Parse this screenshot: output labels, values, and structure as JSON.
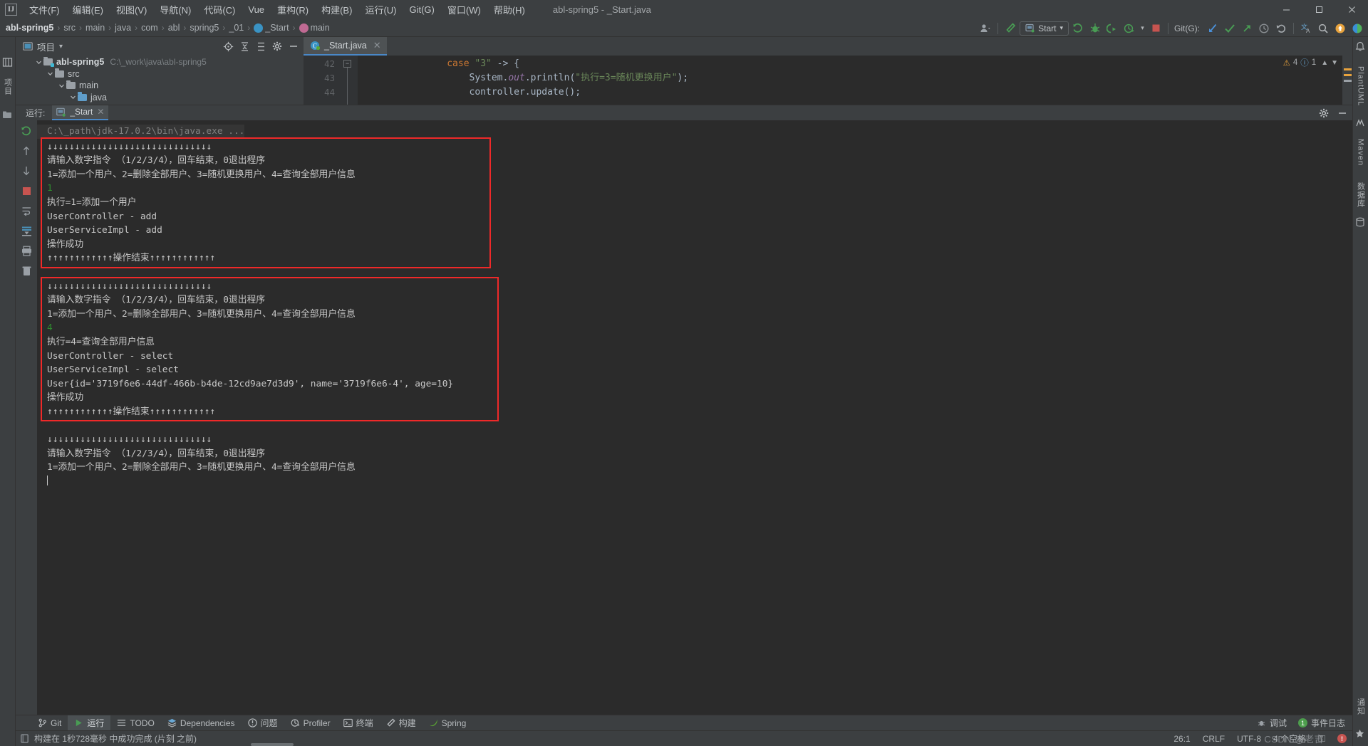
{
  "window": {
    "title": "abl-spring5 - _Start.java",
    "minimize": "–",
    "maximize": "☐",
    "close": "✕"
  },
  "menubar": {
    "logo": "IJ",
    "items": [
      {
        "label": "文件(F)"
      },
      {
        "label": "编辑(E)"
      },
      {
        "label": "视图(V)"
      },
      {
        "label": "导航(N)"
      },
      {
        "label": "代码(C)"
      },
      {
        "label": "Vue"
      },
      {
        "label": "重构(R)"
      },
      {
        "label": "构建(B)"
      },
      {
        "label": "运行(U)"
      },
      {
        "label": "Git(G)"
      },
      {
        "label": "窗口(W)"
      },
      {
        "label": "帮助(H)"
      }
    ]
  },
  "breadcrumb": {
    "items": [
      "abl-spring5",
      "src",
      "main",
      "java",
      "com",
      "abl",
      "spring5",
      "_01",
      "_Start",
      "main"
    ],
    "separator": "›"
  },
  "toolbar": {
    "run_config": "Start",
    "git_label": "Git(G):",
    "chevron": "▾"
  },
  "project_panel": {
    "title": "项目",
    "chevron": "▾",
    "tree": [
      {
        "label": "abl-spring5",
        "path": "C:\\_work\\java\\abl-spring5",
        "depth": 0,
        "expanded": true,
        "bold": true,
        "color": "gray"
      },
      {
        "label": "src",
        "path": "",
        "depth": 1,
        "expanded": true,
        "bold": false,
        "color": "gray"
      },
      {
        "label": "main",
        "path": "",
        "depth": 2,
        "expanded": true,
        "bold": false,
        "color": "gray"
      },
      {
        "label": "java",
        "path": "",
        "depth": 3,
        "expanded": true,
        "bold": false,
        "color": "blue"
      }
    ]
  },
  "editor": {
    "tab": "_Start.java",
    "tab_close": "✕",
    "lines": [
      {
        "num": "42",
        "segments": [
          {
            "t": "                ",
            "c": "plain"
          },
          {
            "t": "case",
            "c": "kw"
          },
          {
            "t": " ",
            "c": "plain"
          },
          {
            "t": "\"3\"",
            "c": "str"
          },
          {
            "t": " -> {",
            "c": "plain"
          }
        ]
      },
      {
        "num": "43",
        "segments": [
          {
            "t": "                    ",
            "c": "plain"
          },
          {
            "t": "System.",
            "c": "plain"
          },
          {
            "t": "out",
            "c": "field"
          },
          {
            "t": ".println(",
            "c": "plain"
          },
          {
            "t": "\"执行=3=随机更换用户\"",
            "c": "str"
          },
          {
            "t": ");",
            "c": "plain"
          }
        ]
      },
      {
        "num": "44",
        "segments": [
          {
            "t": "                    controller.update();",
            "c": "plain"
          }
        ]
      }
    ],
    "warnings": "4",
    "infos": "1"
  },
  "run_window": {
    "label": "运行:",
    "tab": "_Start",
    "tab_close": "✕",
    "command_line": "C:\\_path\\jdk-17.0.2\\bin\\java.exe ...",
    "console": [
      {
        "text": "↓↓↓↓↓↓↓↓↓↓↓↓↓↓↓↓↓↓↓↓↓↓↓↓↓↓↓↓↓↓",
        "style": "normal"
      },
      {
        "text": "请输入数字指令 （1/2/3/4），回车结束，0退出程序",
        "style": "normal"
      },
      {
        "text": "1=添加一个用户、2=删除全部用户、3=随机更换用户、4=查询全部用户信息",
        "style": "normal"
      },
      {
        "text": "1",
        "style": "green"
      },
      {
        "text": "执行=1=添加一个用户",
        "style": "normal"
      },
      {
        "text": "UserController - add",
        "style": "normal"
      },
      {
        "text": "UserServiceImpl - add",
        "style": "normal"
      },
      {
        "text": "操作成功",
        "style": "normal"
      },
      {
        "text": "↑↑↑↑↑↑↑↑↑↑↑↑操作结束↑↑↑↑↑↑↑↑↑↑↑↑",
        "style": "normal"
      },
      {
        "text": "",
        "style": "normal"
      },
      {
        "text": "↓↓↓↓↓↓↓↓↓↓↓↓↓↓↓↓↓↓↓↓↓↓↓↓↓↓↓↓↓↓",
        "style": "normal"
      },
      {
        "text": "请输入数字指令 （1/2/3/4），回车结束，0退出程序",
        "style": "normal"
      },
      {
        "text": "1=添加一个用户、2=删除全部用户、3=随机更换用户、4=查询全部用户信息",
        "style": "normal"
      },
      {
        "text": "4",
        "style": "green"
      },
      {
        "text": "执行=4=查询全部用户信息",
        "style": "normal"
      },
      {
        "text": "UserController - select",
        "style": "normal"
      },
      {
        "text": "UserServiceImpl - select",
        "style": "normal"
      },
      {
        "text": "User{id='3719f6e6-44df-466b-b4de-12cd9ae7d3d9', name='3719f6e6-4', age=10}",
        "style": "normal"
      },
      {
        "text": "操作成功",
        "style": "normal"
      },
      {
        "text": "↑↑↑↑↑↑↑↑↑↑↑↑操作结束↑↑↑↑↑↑↑↑↑↑↑↑",
        "style": "normal"
      },
      {
        "text": "",
        "style": "normal"
      },
      {
        "text": "↓↓↓↓↓↓↓↓↓↓↓↓↓↓↓↓↓↓↓↓↓↓↓↓↓↓↓↓↓↓",
        "style": "normal"
      },
      {
        "text": "请输入数字指令 （1/2/3/4），回车结束，0退出程序",
        "style": "normal"
      },
      {
        "text": "1=添加一个用户、2=删除全部用户、3=随机更换用户、4=查询全部用户信息",
        "style": "normal"
      }
    ],
    "highlight_color": "#ef2929"
  },
  "left_rail": {
    "project_label": "项目",
    "structure_label": ""
  },
  "right_rail": {
    "labels": [
      "PlantUML",
      "Maven",
      "数据库",
      "通知"
    ]
  },
  "bottom_bar": {
    "items": [
      {
        "label": "Git",
        "icon": "git-branch-icon",
        "active": false
      },
      {
        "label": "运行",
        "icon": "run-icon",
        "active": true
      },
      {
        "label": "TODO",
        "icon": "todo-icon",
        "active": false
      },
      {
        "label": "Dependencies",
        "icon": "dependencies-icon",
        "active": false
      },
      {
        "label": "问题",
        "icon": "problems-icon",
        "active": false
      },
      {
        "label": "Profiler",
        "icon": "profiler-icon",
        "active": false
      },
      {
        "label": "终端",
        "icon": "terminal-icon",
        "active": false
      },
      {
        "label": "构建",
        "icon": "build-icon",
        "active": false
      },
      {
        "label": "Spring",
        "icon": "spring-icon",
        "active": false
      }
    ],
    "right": [
      {
        "label": "调试",
        "icon": "debug-icon",
        "badge": ""
      },
      {
        "label": "事件日志",
        "icon": "event-log-icon",
        "badge": "1"
      }
    ]
  },
  "status_bar": {
    "message": "构建在 1秒728毫秒 中成功完成 (片刻 之前)",
    "caret": "26:1",
    "line_sep": "CRLF",
    "encoding": "UTF-8",
    "indent": "4 个空格",
    "watermark": "CSDN @老吉",
    "lock": "⚿"
  }
}
